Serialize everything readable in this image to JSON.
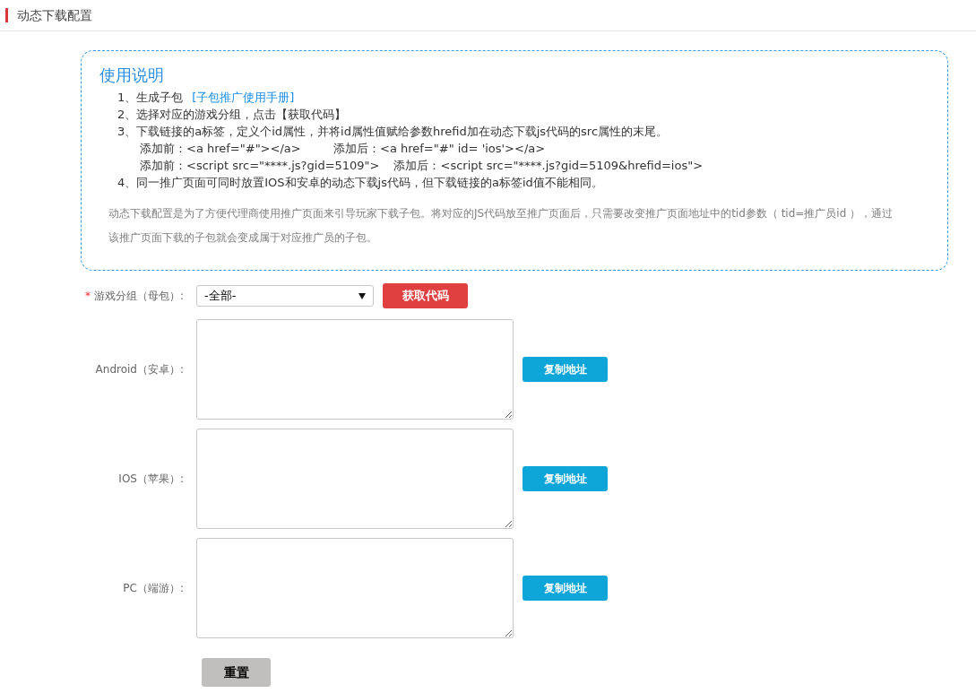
{
  "header": {
    "title": "动态下载配置"
  },
  "instructions": {
    "title": "使用说明",
    "steps": [
      {
        "text": "1、生成子包",
        "link": "[子包推广使用手册]"
      },
      {
        "text": "2、选择对应的游戏分组，点击【获取代码】"
      },
      {
        "text": "3、下载链接的a标签，定义个id属性，并将id属性值赋给参数hrefid加在动态下载js代码的src属性的末尾。",
        "examples": [
          {
            "before": "添加前：<a href=\"#\"></a>",
            "after": "添加后：<a href=\"#\" id= 'ios'></a>"
          },
          {
            "before": "添加前：<script src=\"****.js?gid=5109\">",
            "after": "添加后：<script src=\"****.js?gid=5109&hrefid=ios\">"
          }
        ]
      },
      {
        "text": "4、同一推广页面可同时放置IOS和安卓的动态下载js代码，但下载链接的a标签id值不能相同。"
      }
    ],
    "note": "动态下载配置是为了方便代理商使用推广页面来引导玩家下载子包。将对应的JS代码放至推广页面后，只需要改变推广页面地址中的tid参数（ tid=推广员id ），通过该推广页面下载的子包就会变成属于对应推广员的子包。"
  },
  "group_field": {
    "label": "游戏分组（母包）:",
    "required_mark": "*",
    "value": "-全部-",
    "button": "获取代码"
  },
  "outputs": [
    {
      "label": "Android（安卓）:",
      "button": "复制地址"
    },
    {
      "label": "IOS（苹果）:",
      "button": "复制地址"
    },
    {
      "label": "PC（端游）:",
      "button": "复制地址"
    }
  ],
  "reset_button": "重置"
}
